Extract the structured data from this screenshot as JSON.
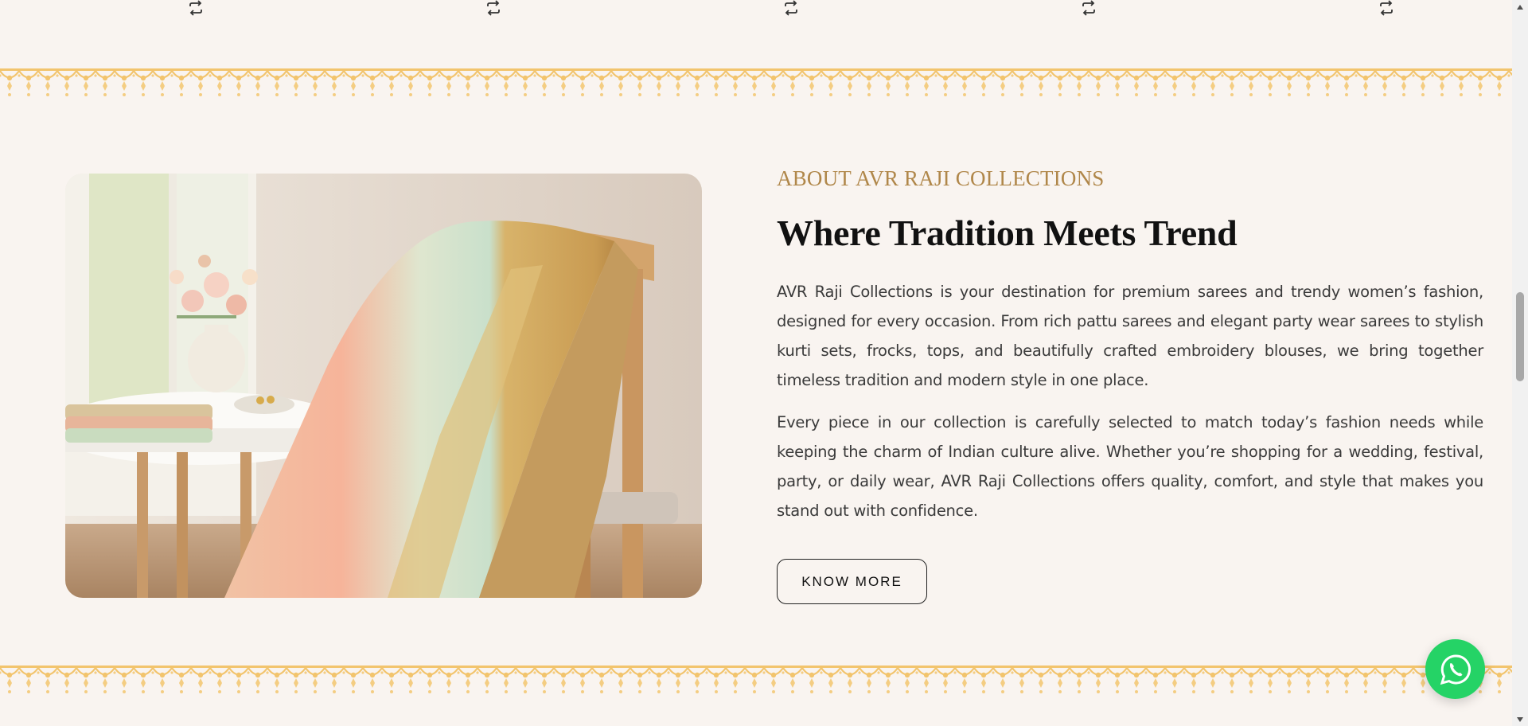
{
  "compare_icons": [
    {
      "name": "compare-icon"
    },
    {
      "name": "compare-icon"
    },
    {
      "name": "compare-icon"
    },
    {
      "name": "compare-icon"
    },
    {
      "name": "compare-icon"
    }
  ],
  "about": {
    "eyebrow": "ABOUT AVR RAJI COLLECTIONS",
    "headline": "Where Tradition Meets Trend",
    "paragraphs": [
      "AVR Raji Collections is your destination for premium sarees and trendy women’s fashion, designed for every occasion. From rich pattu sarees and elegant party wear sarees to stylish kurti sets, frocks, tops, and beautifully crafted embroidery blouses, we bring together timeless tradition and modern style in one place.",
      "Every piece in our collection is carefully selected to match today’s fashion needs while keeping the charm of Indian culture alive. Whether you’re shopping for a wedding, festival, party, or daily wear, AVR Raji Collections offers quality, comfort, and style that makes you stand out with confidence."
    ],
    "button_label": "KNOW MORE",
    "image_icon": "saree-on-chair-photo"
  },
  "whatsapp": {
    "icon": "whatsapp-icon"
  },
  "colors": {
    "background": "#f9f4f0",
    "accent_gold": "#b0874a",
    "border_gold": "#f2c46d",
    "whatsapp_green": "#25d366"
  }
}
